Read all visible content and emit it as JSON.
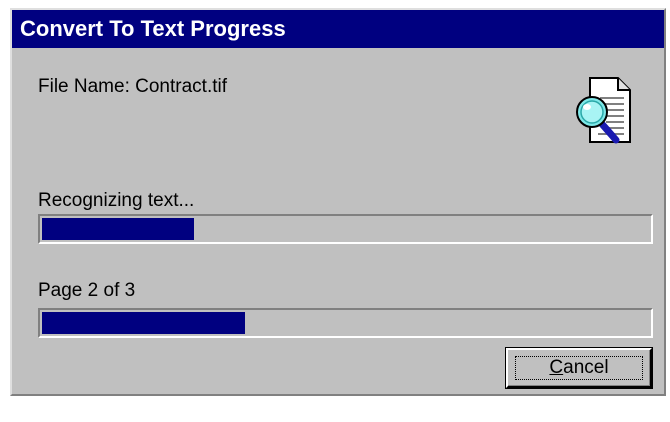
{
  "window": {
    "title": "Convert To Text Progress"
  },
  "file": {
    "label": "File Name: Contract.tif"
  },
  "status": {
    "text": "Recognizing text...",
    "progress_fraction": 0.25
  },
  "page": {
    "text": "Page 2 of 3",
    "progress_fraction": 0.335
  },
  "buttons": {
    "cancel_label": "Cancel"
  },
  "icons": {
    "document": "document-magnifier-icon"
  },
  "colors": {
    "titlebar": "#000080",
    "progress_fill": "#000080",
    "dialog_face": "#c0c0c0"
  }
}
